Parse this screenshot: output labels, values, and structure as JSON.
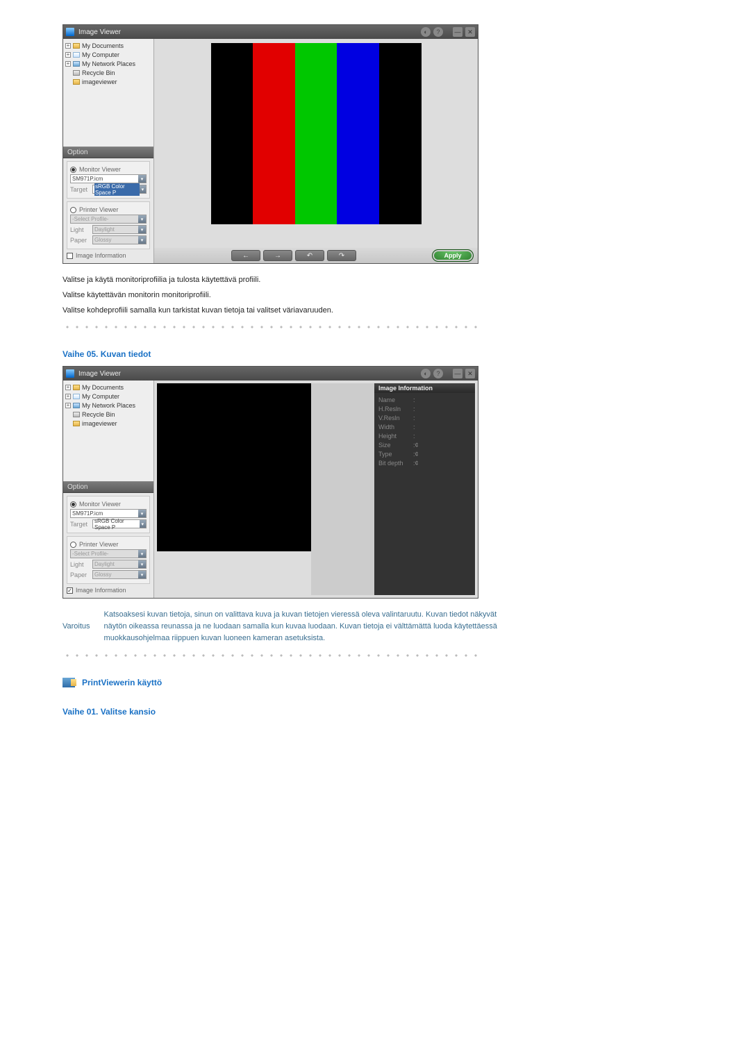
{
  "window_title": "Image Viewer",
  "tree": {
    "items": [
      {
        "label": "My Documents"
      },
      {
        "label": "My Computer"
      },
      {
        "label": "My Network Places"
      },
      {
        "label": "Recycle Bin"
      },
      {
        "label": "imageviewer"
      }
    ]
  },
  "option_header": "Option",
  "monitor_viewer": {
    "label": "Monitor Viewer",
    "profile": "SM971P.icm",
    "target_label": "Target",
    "target_value": "sRGB Color Space P"
  },
  "printer_viewer": {
    "label": "Printer Viewer",
    "profile_placeholder": "-Select Profile-",
    "light_label": "Light",
    "light_value": "Daylight",
    "paper_label": "Paper",
    "paper_value": "Glossy"
  },
  "image_info_label": "Image Information",
  "toolbar": {
    "apply": "Apply"
  },
  "info_panel": {
    "header": "Image Information",
    "fields": {
      "name": "Name",
      "hres": "H.Resln",
      "vres": "V.Resln",
      "width": "Width",
      "height": "Height",
      "size": "Size",
      "type": "Type",
      "bitdepth": "Bit depth"
    },
    "na": "¢"
  },
  "body_text": {
    "p1": "Valitse ja käytä monitoriprofiilia ja tulosta käytettävä profiili.",
    "p2": "Valitse käytettävän monitorin monitoriprofiili.",
    "p3": "Valitse kohdeprofiili samalla kun tarkistat kuvan tietoja tai valitset väriavaruuden."
  },
  "step05_title": "Vaihe 05. Kuvan tiedot",
  "note": {
    "label": "Varoitus",
    "text": "Katsoaksesi kuvan tietoja, sinun on valittava kuva ja kuvan tietojen vieressä oleva valintaruutu. Kuvan tiedot näkyvät näytön oikeassa reunassa ja ne luodaan samalla kun kuvaa luodaan. Kuvan tietoja ei välttämättä luoda käytettäessä muokkausohjelmaa riippuen kuvan luoneen kameran asetuksista."
  },
  "sec_pv_title": "PrintViewerin käyttö",
  "step01_title": "Vaihe 01. Valitse kansio",
  "chart_data": {
    "type": "bar",
    "categories": [
      "black",
      "red",
      "green",
      "blue",
      "black"
    ],
    "colors": [
      "#000000",
      "#e10000",
      "#00c700",
      "#0000e1",
      "#000000"
    ],
    "title": "RGB color test bars"
  }
}
